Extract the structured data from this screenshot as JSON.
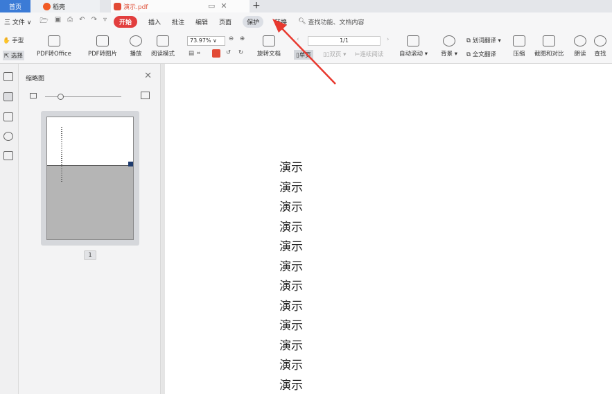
{
  "tabs": {
    "home": "首页",
    "daoke": "稻壳",
    "pdf": "演示.pdf"
  },
  "menu": {
    "file": "三 文件 ∨",
    "items": [
      "开始",
      "插入",
      "批注",
      "编辑",
      "页面",
      "保护",
      "转换"
    ],
    "search": "查找功能、文档内容"
  },
  "toolbar": {
    "hand": "手型",
    "select": "选择",
    "pdf_to_office": "PDF转Office",
    "pdf_to_image": "PDF转图片",
    "play": "播放",
    "read_mode": "阅读模式",
    "zoom": "73.97%",
    "rotate": "旋转文档",
    "page": "1/1",
    "single": "单页",
    "double": "双页",
    "continuous": "连续阅读",
    "auto_scroll": "自动滚动",
    "background": "背景",
    "word_translate": "划词翻译",
    "full_translate": "全文翻译",
    "compress": "压缩",
    "screenshot_compare": "截图和对比",
    "read_aloud": "朗读",
    "find": "查找"
  },
  "thumbnail_panel": {
    "title": "缩略图",
    "page_number": "1"
  },
  "document": {
    "lines": [
      "演示",
      "演示",
      "演示",
      "演示",
      "演示",
      "演示",
      "演示",
      "演示",
      "演示",
      "演示",
      "演示",
      "演示"
    ]
  },
  "colors": {
    "accent_red": "#e23e3e",
    "home_tab_blue": "#3b7bd6",
    "arrow_red": "#e8392f"
  }
}
